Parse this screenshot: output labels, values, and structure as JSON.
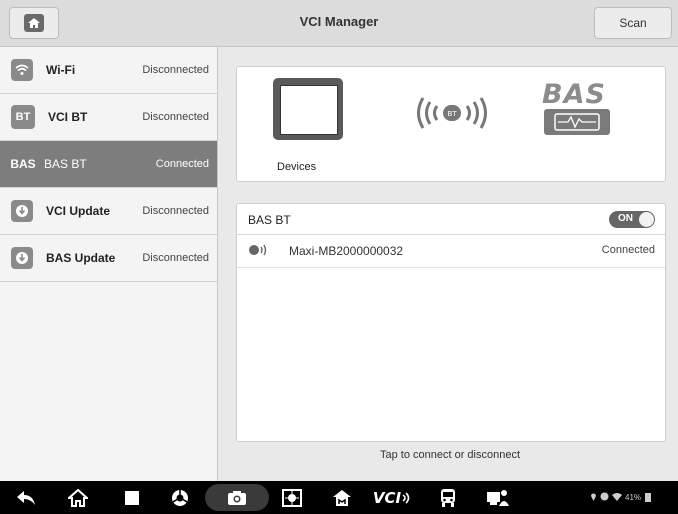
{
  "header": {
    "title": "VCI Manager",
    "scan_label": "Scan",
    "home_icon": "home-icon"
  },
  "sidebar": {
    "items": [
      {
        "icon": "wifi-icon",
        "label": "Wi-Fi",
        "status": "Disconnected"
      },
      {
        "icon": "BT",
        "label": "VCI BT",
        "status": "Disconnected"
      },
      {
        "icon": "BAS",
        "label": "BAS BT",
        "status": "Connected",
        "active": true
      },
      {
        "icon": "update-icon",
        "label": "VCI Update",
        "status": "Disconnected"
      },
      {
        "icon": "update-icon",
        "label": "BAS Update",
        "status": "Disconnected"
      }
    ]
  },
  "devices": {
    "label": "Devices",
    "logo_text": "BAS"
  },
  "bluetooth": {
    "title": "BAS BT",
    "toggle_label": "ON",
    "devices": [
      {
        "name": "Maxi-MB2000000032",
        "status": "Connected"
      }
    ]
  },
  "hint": "Tap to connect or disconnect",
  "navbar": {
    "vci_label": "VCI",
    "status_text": "41%"
  },
  "colors": {
    "active_item": "#7d7d7d",
    "header_bg": "#dcdcdc",
    "navbar_bg": "#000000"
  }
}
